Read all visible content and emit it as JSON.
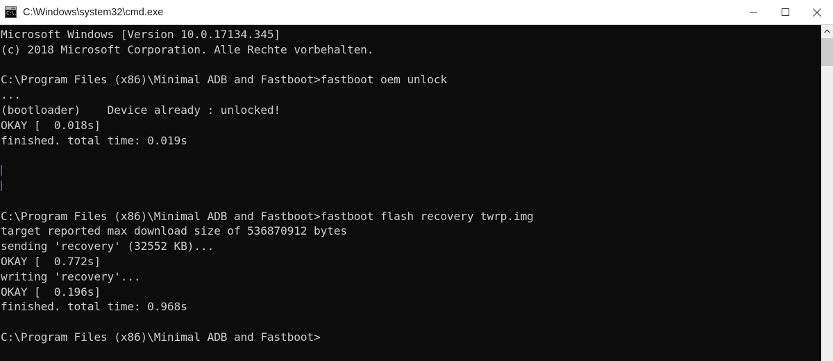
{
  "window": {
    "title": "C:\\Windows\\system32\\cmd.exe",
    "icon_name": "cmd-console-icon",
    "icon_glyph": "C:\\.",
    "background_color": "#0c0c0c",
    "titlebar_color": "#ffffff",
    "text_color": "#cccccc"
  },
  "controls": {
    "minimize_label": "Minimize",
    "maximize_label": "Maximize",
    "close_label": "Close"
  },
  "scrollbar": {
    "up_arrow_label": "Scroll up"
  },
  "console": {
    "lines": [
      "Microsoft Windows [Version 10.0.17134.345]",
      "(c) 2018 Microsoft Corporation. Alle Rechte vorbehalten.",
      "",
      "C:\\Program Files (x86)\\Minimal ADB and Fastboot>fastboot oem unlock",
      "...",
      "(bootloader)    Device already : unlocked!",
      "OKAY [  0.018s]",
      "finished. total time: 0.019s",
      "",
      "",
      "",
      "",
      "C:\\Program Files (x86)\\Minimal ADB and Fastboot>fastboot flash recovery twrp.img",
      "target reported max download size of 536870912 bytes",
      "sending 'recovery' (32552 KB)...",
      "OKAY [  0.772s]",
      "writing 'recovery'...",
      "OKAY [  0.196s]",
      "finished. total time: 0.968s",
      "",
      "C:\\Program Files (x86)\\Minimal ADB and Fastboot>"
    ],
    "marked_line_indexes": [
      9,
      10
    ]
  }
}
